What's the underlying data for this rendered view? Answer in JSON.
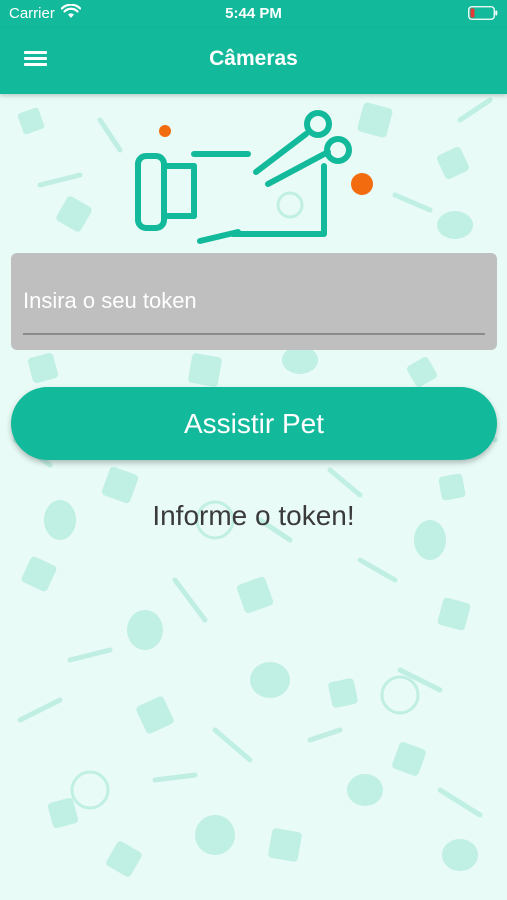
{
  "statusbar": {
    "carrier": "Carrier",
    "time": "5:44 PM",
    "wifi_icon": "wifi-icon",
    "battery_icon": "battery-icon"
  },
  "navbar": {
    "title": "Câmeras",
    "menu_icon": "hamburger-menu-icon"
  },
  "logo_icon": "camera-logo-icon",
  "token": {
    "placeholder": "Insira o seu token",
    "value": ""
  },
  "watch_button": {
    "label": "Assistir Pet"
  },
  "message": "Informe o token!",
  "colors": {
    "primary": "#13b99b",
    "accent": "#f26b0f",
    "background": "#e8fbf6",
    "field": "#bfbfbf"
  }
}
